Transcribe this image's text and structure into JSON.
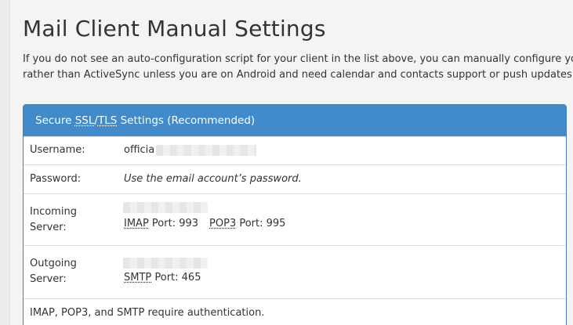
{
  "heading": "Mail Client Manual Settings",
  "intro": {
    "line1": "If you do not see an auto-configuration script for your client in the list above, you can manually configure you",
    "line2": "rather than ActiveSync unless you are on Android and need calendar and contacts support or push updates."
  },
  "panel": {
    "title_prefix": "Secure ",
    "title_ssl": "SSL",
    "title_slash": "/",
    "title_tls": "TLS",
    "title_suffix": " Settings (Recommended)",
    "username": {
      "label": "Username:",
      "value_visible": "officia"
    },
    "password": {
      "label": "Password:",
      "value": "Use the email account’s password."
    },
    "incoming": {
      "label_line1": "Incoming",
      "label_line2": "Server:",
      "imap_abbr": "IMAP",
      "imap_port_text": " Port: 993",
      "pop3_abbr": "POP3",
      "pop3_port_text": " Port: 995"
    },
    "outgoing": {
      "label_line1": "Outgoing",
      "label_line2": "Server:",
      "smtp_abbr": "SMTP",
      "smtp_port_text": " Port: 465"
    },
    "auth_note": "IMAP, POP3, and SMTP require authentication."
  },
  "colors": {
    "panel_header": "#428bca",
    "panel_border": "#3f82c4",
    "background": "#f4f4f4"
  }
}
